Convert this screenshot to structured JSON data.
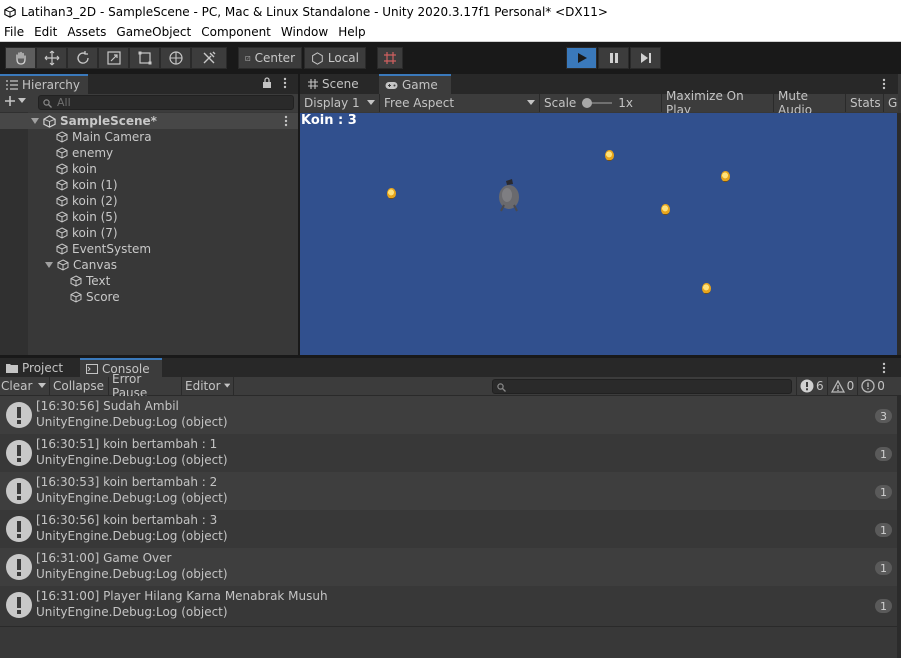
{
  "window": {
    "title": "Latihan3_2D - SampleScene - PC, Mac & Linux Standalone - Unity 2020.3.17f1 Personal* <DX11>"
  },
  "menu": [
    "File",
    "Edit",
    "Assets",
    "GameObject",
    "Component",
    "Window",
    "Help"
  ],
  "toolbar": {
    "pivot_label": "Center",
    "space_label": "Local"
  },
  "hierarchy": {
    "tab_label": "Hierarchy",
    "search_placeholder": "All",
    "scene_name": "SampleScene*",
    "items": [
      {
        "label": "Main Camera"
      },
      {
        "label": "enemy"
      },
      {
        "label": "koin"
      },
      {
        "label": "koin (1)"
      },
      {
        "label": "koin (2)"
      },
      {
        "label": "koin (5)"
      },
      {
        "label": "koin (7)"
      },
      {
        "label": "EventSystem"
      },
      {
        "label": "Canvas"
      },
      {
        "label": "Text"
      },
      {
        "label": "Score"
      }
    ]
  },
  "game_panel": {
    "tabs": [
      "Scene",
      "Game"
    ],
    "display": "Display 1",
    "aspect": "Free Aspect",
    "scale_label": "Scale",
    "scale_value": "1x",
    "maximize": "Maximize On Play",
    "mute": "Mute Audio",
    "stats": "Stats",
    "gizmos": "G",
    "score_text": "Koin : 3"
  },
  "console": {
    "tabs": [
      "Project",
      "Console"
    ],
    "clear": "Clear",
    "collapse": "Collapse",
    "error_pause": "Error Pause",
    "editor": "Editor",
    "log_count": "6",
    "warn_count": "0",
    "error_count": "0",
    "logs": [
      {
        "line1": "[16:30:56] Sudah Ambil",
        "line2": "UnityEngine.Debug:Log (object)",
        "count": "3"
      },
      {
        "line1": "[16:30:51] koin bertambah : 1",
        "line2": "UnityEngine.Debug:Log (object)",
        "count": "1"
      },
      {
        "line1": "[16:30:53] koin bertambah : 2",
        "line2": "UnityEngine.Debug:Log (object)",
        "count": "1"
      },
      {
        "line1": "[16:30:56] koin bertambah : 3",
        "line2": "UnityEngine.Debug:Log (object)",
        "count": "1"
      },
      {
        "line1": "[16:31:00] Game Over",
        "line2": "UnityEngine.Debug:Log (object)",
        "count": "1"
      },
      {
        "line1": "[16:31:00] Player Hilang Karna Menabrak Musuh",
        "line2": "UnityEngine.Debug:Log (object)",
        "count": "1"
      }
    ]
  }
}
